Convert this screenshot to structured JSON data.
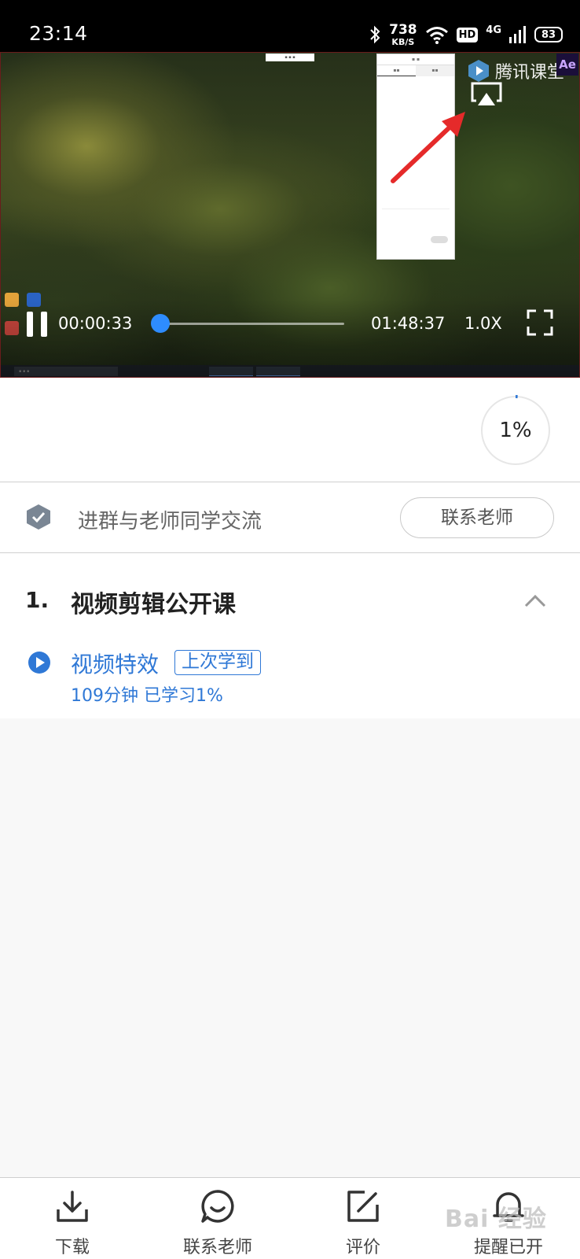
{
  "status_bar": {
    "time": "23:14",
    "net_speed_value": "738",
    "net_speed_unit": "KB/S",
    "hd_label": "HD",
    "network_label": "4G",
    "battery": "83",
    "icons": [
      "bluetooth-icon",
      "wifi-icon",
      "signal-icon",
      "battery-icon"
    ]
  },
  "player": {
    "brand_name": "腾讯课堂",
    "ae_badge": "Ae",
    "current_time": "00:00:33",
    "total_time": "01:48:37",
    "speed": "1.0X",
    "played_fraction": 0.005,
    "accent_color": "#2e8cff"
  },
  "progress": {
    "percent_label": "1%",
    "percent_value": 1
  },
  "group": {
    "text": "进群与老师同学交流",
    "contact_button": "联系老师"
  },
  "course": {
    "chapter_number": "1.",
    "chapter_title": "视频剪辑公开课",
    "lesson": {
      "title": "视频特效",
      "badge": "上次学到",
      "meta": "109分钟  已学习1%"
    },
    "link_color": "#2f78d6"
  },
  "bottom_nav": [
    {
      "label": "下载",
      "icon": "download-icon"
    },
    {
      "label": "联系老师",
      "icon": "chat-icon"
    },
    {
      "label": "评价",
      "icon": "edit-icon"
    },
    {
      "label": "提醒已开",
      "icon": "bell-icon"
    }
  ],
  "watermark": "Bai 经验"
}
